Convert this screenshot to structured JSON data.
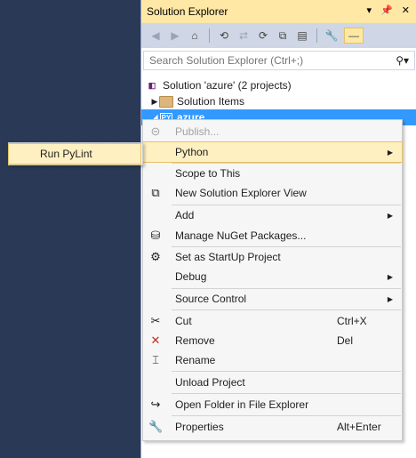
{
  "solution_explorer": {
    "title": "Solution Explorer",
    "search_placeholder": "Search Solution Explorer (Ctrl+;)",
    "tree": {
      "solution": "Solution 'azure' (2 projects)",
      "solution_items": "Solution Items",
      "project": "azure"
    }
  },
  "context_menu": {
    "publish": "Publish...",
    "python": "Python",
    "scope_to_this": "Scope to This",
    "new_view": "New Solution Explorer View",
    "add": "Add",
    "manage_nuget": "Manage NuGet Packages...",
    "set_startup": "Set as StartUp Project",
    "debug": "Debug",
    "source_control": "Source Control",
    "cut": "Cut",
    "cut_shortcut": "Ctrl+X",
    "remove": "Remove",
    "remove_shortcut": "Del",
    "rename": "Rename",
    "unload": "Unload Project",
    "open_folder": "Open Folder in File Explorer",
    "properties": "Properties",
    "properties_shortcut": "Alt+Enter"
  },
  "submenu": {
    "run_pylint": "Run PyLint"
  },
  "colors": {
    "background": "#293955",
    "selection": "#3399ff",
    "highlight": "#fff0c2",
    "titlebar": "#ffe8a6"
  }
}
